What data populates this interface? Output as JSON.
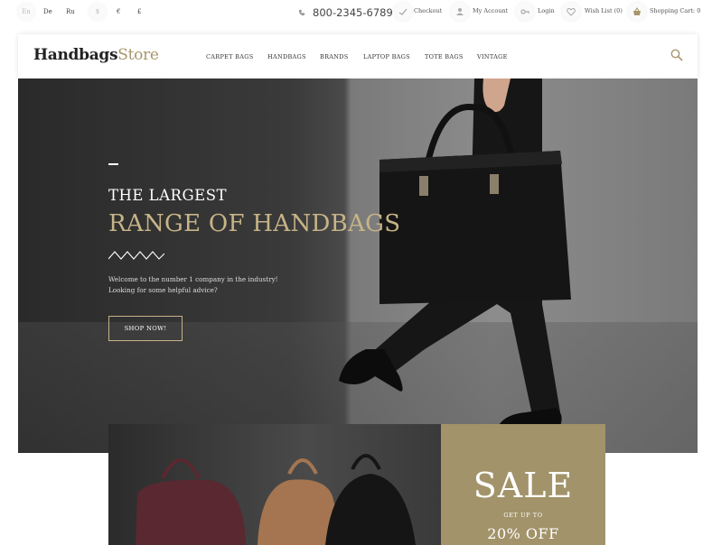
{
  "topbar": {
    "languages": [
      "En",
      "De",
      "Ru"
    ],
    "currencies": [
      "$",
      "€",
      "£"
    ],
    "phone": "800-2345-6789",
    "links": {
      "checkout": "Checkout",
      "account": "My Account",
      "login": "Login",
      "wishlist": "Wish List (0)",
      "cart": "Shopping Cart: 0"
    }
  },
  "header": {
    "logo_main": "Handbags",
    "logo_accent": "Store",
    "nav": [
      "CARPET BAGS",
      "HANDBAGS",
      "BRANDS",
      "LAPTOP BAGS",
      "TOTE BAGS",
      "VINTAGE"
    ]
  },
  "hero": {
    "title_line1": "THE LARGEST",
    "title_line2": "RANGE OF HANDBAGS",
    "desc_line1": "Welcome to the number 1 company in the industry!",
    "desc_line2": "Looking for some helpful advice?",
    "button": "SHOP NOW!"
  },
  "promo": {
    "sale": "SALE",
    "sub": "GET UP TO",
    "off": "20% OFF"
  },
  "colors": {
    "accent": "#a8966c",
    "sale_bg": "#a2936a",
    "hero_gold": "#c7b487"
  }
}
